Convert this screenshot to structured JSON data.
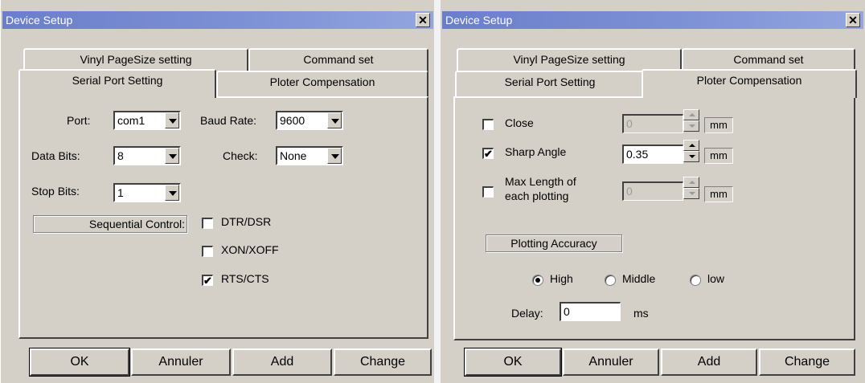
{
  "dialogs": [
    {
      "title": "Device Setup",
      "tabs_back": [
        "Vinyl PageSize setting",
        "Command set"
      ],
      "tabs_front": [
        "Serial Port Setting",
        "Ploter Compensation"
      ],
      "active_tab": "Serial Port Setting",
      "serial": {
        "port_label": "Port:",
        "port_value": "com1",
        "baud_label": "Baud Rate:",
        "baud_value": "9600",
        "databits_label": "Data Bits:",
        "databits_value": "8",
        "check_label": "Check:",
        "check_value": "None",
        "stopbits_label": "Stop Bits:",
        "stopbits_value": "1",
        "sequential_label": "Sequential Control:",
        "options": [
          {
            "label": "DTR/DSR",
            "checked": false
          },
          {
            "label": "XON/XOFF",
            "checked": false
          },
          {
            "label": "RTS/CTS",
            "checked": true
          }
        ]
      },
      "buttons": [
        "OK",
        "Annuler",
        "Add",
        "Change"
      ]
    },
    {
      "title": "Device Setup",
      "tabs_back": [
        "Vinyl PageSize setting",
        "Command set"
      ],
      "tabs_front": [
        "Serial Port Setting",
        "Ploter Compensation"
      ],
      "active_tab": "Ploter Compensation",
      "compensation": {
        "close_label": "Close",
        "close_checked": false,
        "close_value": "0",
        "sharp_label": "Sharp Angle",
        "sharp_checked": true,
        "sharp_value": "0.35",
        "maxlen_label_line1": "Max Length of",
        "maxlen_label_line2": "each plotting",
        "maxlen_checked": false,
        "maxlen_value": "0",
        "unit": "mm",
        "accuracy_label": "Plotting Accuracy",
        "accuracy_options": [
          "High",
          "Middle",
          "low"
        ],
        "accuracy_selected": "High",
        "delay_label": "Delay:",
        "delay_value": "0",
        "delay_unit": "ms"
      },
      "buttons": [
        "OK",
        "Annuler",
        "Add",
        "Change"
      ]
    }
  ],
  "checkmark": "✔"
}
